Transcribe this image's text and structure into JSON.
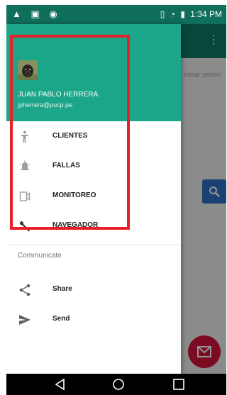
{
  "status_bar": {
    "time": "1:34 PM"
  },
  "background_app": {
    "hint_text": "iniciar sesión"
  },
  "drawer": {
    "user_name": "JUAN PABLO HERRERA",
    "user_email": "jpherrera@pucp.pe",
    "items": [
      {
        "label": "CLIENTES",
        "icon": "person-icon"
      },
      {
        "label": "FALLAS",
        "icon": "alarm-icon"
      },
      {
        "label": "MONITOREO",
        "icon": "video-camera-icon"
      },
      {
        "label": "NAVEGADOR",
        "icon": "wrench-icon"
      }
    ],
    "section_label": "Communicate",
    "communicate_items": [
      {
        "label": "Share",
        "icon": "share-icon"
      },
      {
        "label": "Send",
        "icon": "send-icon"
      }
    ]
  },
  "colors": {
    "primary_dark": "#0f6f5b",
    "header_teal": "#1ba589",
    "highlight_red": "#e6212c",
    "fab_red": "#d4143c",
    "search_blue": "#2f6ec5"
  }
}
